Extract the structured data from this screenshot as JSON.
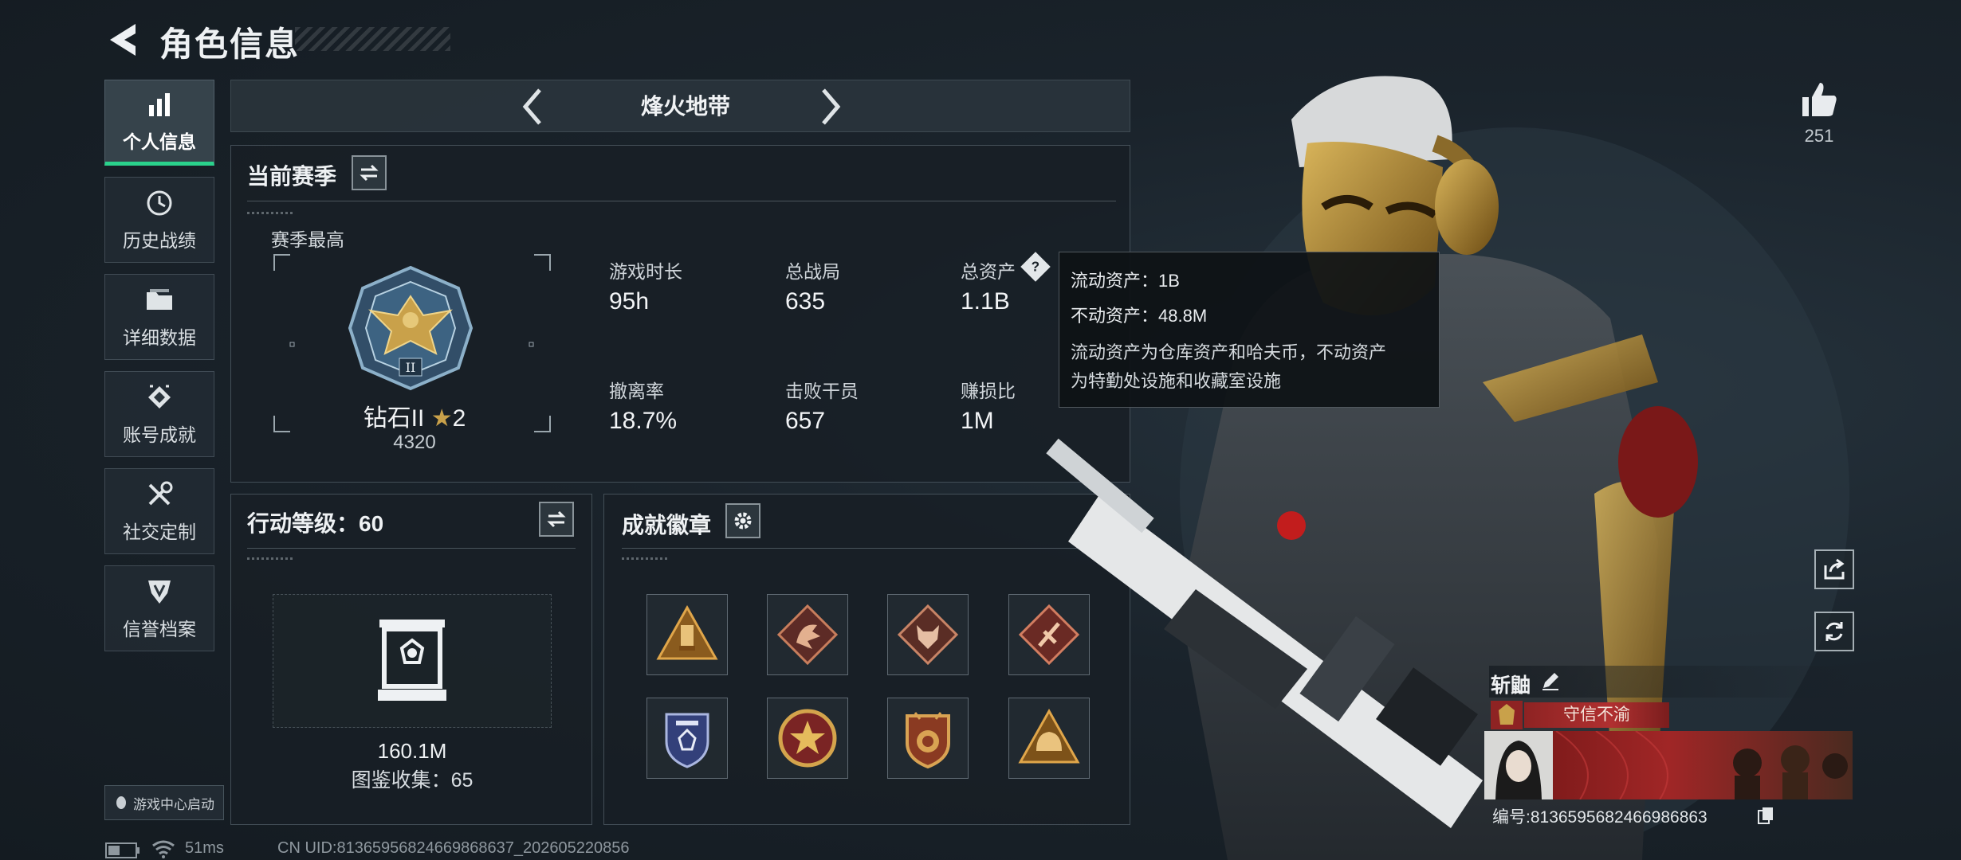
{
  "header": {
    "title": "角色信息"
  },
  "nav": {
    "items": [
      {
        "label": "个人信息",
        "icon": "bar-chart-icon",
        "active": true
      },
      {
        "label": "历史战绩",
        "icon": "history-icon"
      },
      {
        "label": "详细数据",
        "icon": "folder-icon"
      },
      {
        "label": "账号成就",
        "icon": "achievement-icon"
      },
      {
        "label": "社交定制",
        "icon": "tools-icon"
      },
      {
        "label": "信誉档案",
        "icon": "credit-shield-icon"
      }
    ],
    "game_center_label": "游戏中心启动"
  },
  "mode": {
    "title": "烽火地带"
  },
  "season": {
    "title": "当前赛季",
    "best_label": "赛季最高",
    "rank_name": "钻石II",
    "rank_stars": "2",
    "rank_score": "4320",
    "stats": [
      {
        "label": "游戏时长",
        "value": "95h"
      },
      {
        "label": "总战局",
        "value": "635"
      },
      {
        "label": "总资产",
        "value": "1.1B"
      },
      {
        "label": "撤离率",
        "value": "18.7%"
      },
      {
        "label": "击败干员",
        "value": "657"
      },
      {
        "label": "赚损比",
        "value": "1M"
      }
    ]
  },
  "tooltip": {
    "liquid": "流动资产：1B",
    "fixed": "不动资产：48.8M",
    "desc_line1": "流动资产为仓库资产和哈夫币，不动资产",
    "desc_line2": "为特勤处设施和收藏室设施"
  },
  "action_level": {
    "title": "行动等级：60",
    "value": "160.1M",
    "collection": "图鉴收集：65"
  },
  "achievements": {
    "title": "成就徽章",
    "badges": [
      {
        "icon": "bullet-triangle-badge-icon"
      },
      {
        "icon": "dragon-badge-icon"
      },
      {
        "icon": "wolf-badge-icon"
      },
      {
        "icon": "sword-badge-icon"
      },
      {
        "icon": "shield-star-badge-icon"
      },
      {
        "icon": "star-medal-badge-icon"
      },
      {
        "icon": "crest-badge-icon"
      },
      {
        "icon": "helmet-triangle-badge-icon"
      }
    ]
  },
  "social": {
    "likes": "251",
    "player_name": "斩鼬",
    "title_tag": "守信不渝",
    "player_id": "编号:8136595682466986863"
  },
  "footer": {
    "ping": "51ms",
    "uid": "CN UID:81365956824669868637_202605220856"
  },
  "colors": {
    "accent": "#2ad28c",
    "tag_red": "#8e2323",
    "gold": "#c9a14a"
  }
}
